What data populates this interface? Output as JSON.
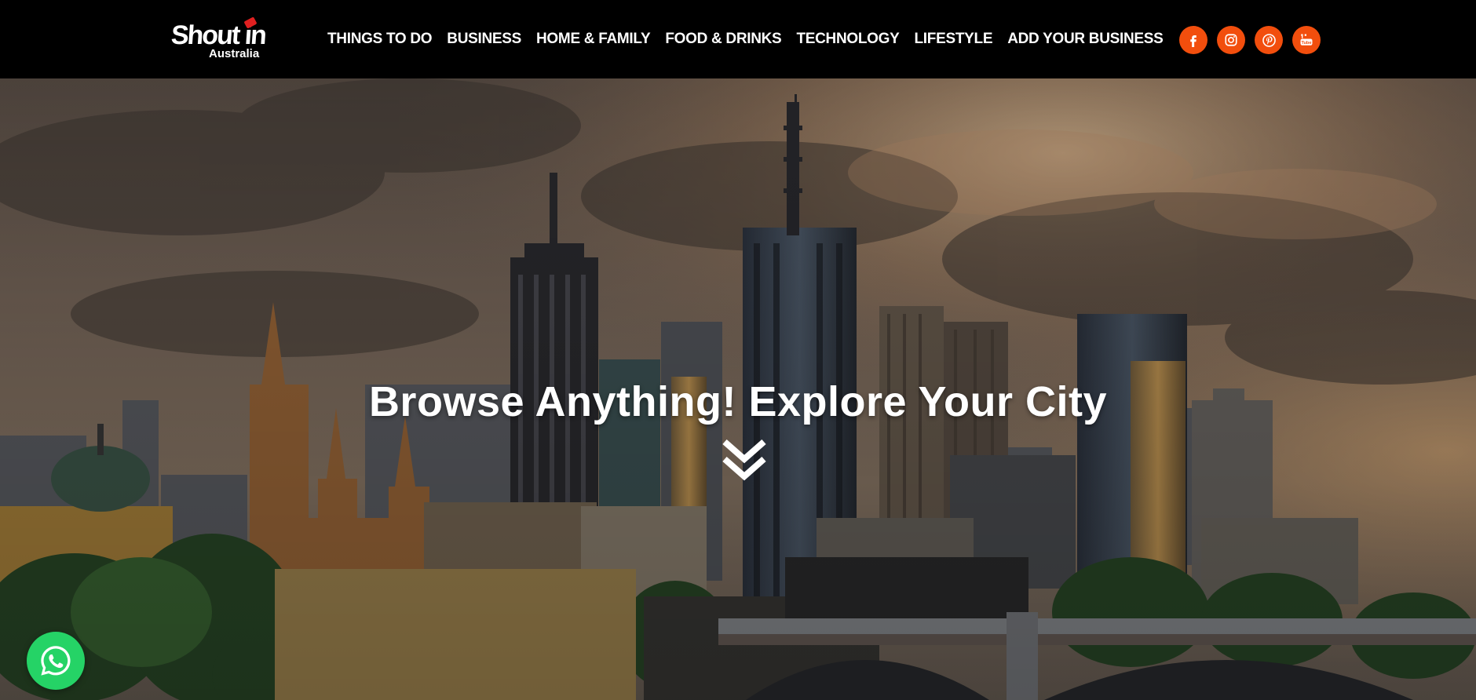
{
  "brand": {
    "logo_main": "Shout in",
    "logo_sub": "Australia"
  },
  "nav": {
    "items": [
      {
        "label": "THINGS TO DO"
      },
      {
        "label": "BUSINESS"
      },
      {
        "label": "HOME & FAMILY"
      },
      {
        "label": "FOOD & DRINKS"
      },
      {
        "label": "TECHNOLOGY"
      },
      {
        "label": "LIFESTYLE"
      },
      {
        "label": "ADD YOUR BUSINESS"
      }
    ]
  },
  "social": {
    "icons": [
      "facebook-icon",
      "instagram-icon",
      "pinterest-icon",
      "youtube-icon"
    ],
    "color": "#f24e0d"
  },
  "hero": {
    "title": "Browse Anything! Explore Your City",
    "scroll_icon": "double-chevron-down-icon"
  },
  "whatsapp": {
    "icon": "whatsapp-icon",
    "color": "#25d366"
  }
}
